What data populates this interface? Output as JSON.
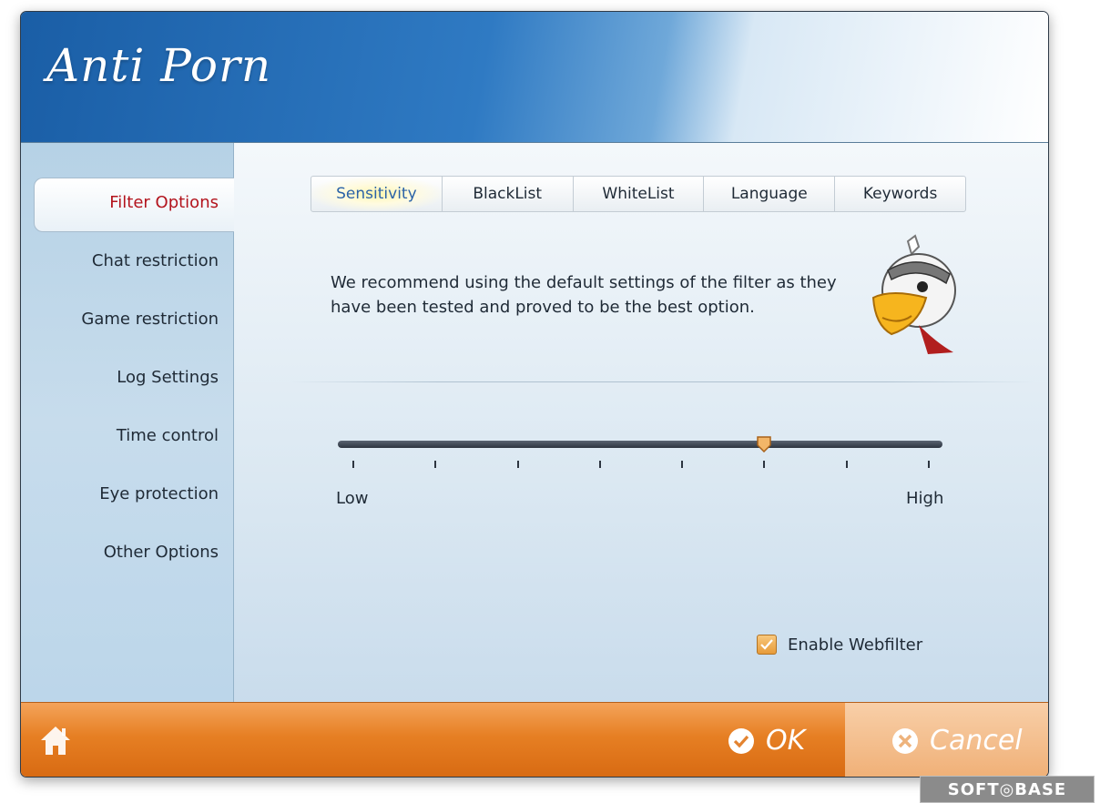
{
  "app": {
    "title": "Anti Porn"
  },
  "sidebar": {
    "items": [
      {
        "label": "Filter Options",
        "active": true
      },
      {
        "label": "Chat restriction"
      },
      {
        "label": "Game restriction"
      },
      {
        "label": "Log Settings"
      },
      {
        "label": "Time control"
      },
      {
        "label": "Eye protection"
      },
      {
        "label": "Other Options"
      }
    ]
  },
  "tabs": [
    {
      "label": "Sensitivity",
      "active": true
    },
    {
      "label": "BlackList"
    },
    {
      "label": "WhiteList"
    },
    {
      "label": "Language"
    },
    {
      "label": "Keywords"
    }
  ],
  "sensitivity": {
    "description": "We recommend using the default settings of the filter as they have been tested and proved to be the best option.",
    "slider": {
      "min_label": "Low",
      "max_label": "High",
      "steps": 8,
      "value_step": 5,
      "tick_count": 8
    },
    "webfilter": {
      "label": "Enable Webfilter",
      "checked": true
    }
  },
  "footer": {
    "ok_label": "OK",
    "cancel_label": "Cancel"
  },
  "watermark": {
    "text": "SOFT◎BASE"
  },
  "colors": {
    "header_blue": "#1a5ea6",
    "active_red": "#b3141d",
    "footer_orange": "#e67f23",
    "active_tab_blue": "#2b63a8"
  },
  "icons": {
    "home": "home-icon",
    "ok": "check-circle-icon",
    "cancel": "x-circle-icon",
    "mascot": "eagle-mascot",
    "checkbox": "checkmark-icon"
  }
}
